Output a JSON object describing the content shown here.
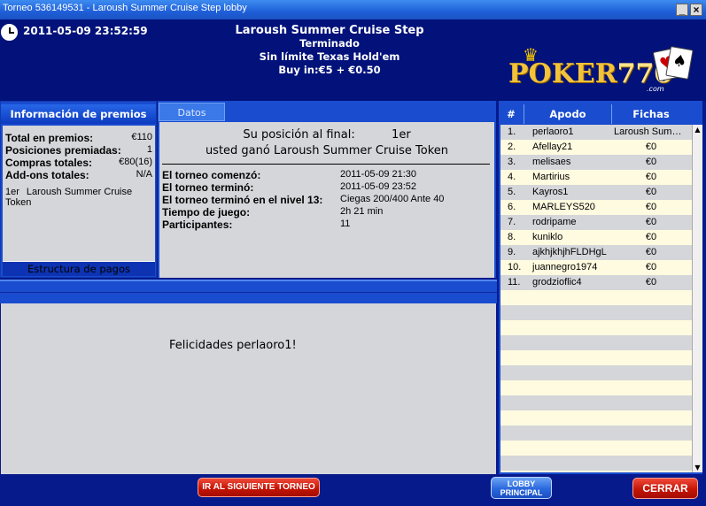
{
  "window": {
    "title": "Torneo 536149531 - Laroush Summer Cruise Step lobby",
    "minimize": "_",
    "close": "×"
  },
  "header": {
    "datetime": "2011-05-09 23:52:59",
    "name": "Laroush Summer Cruise Step",
    "status": "Terminado",
    "game": "Sin límite Texas Hold'em",
    "buyin": "Buy in:€5 + €0.50",
    "logo_text": "POKER",
    "logo_num": "770",
    "logo_com": ".com"
  },
  "prizes": {
    "title": "Información de premios",
    "rows": [
      {
        "k": "Total en premios:",
        "v": "€110"
      },
      {
        "k": "Posiciones premiadas:",
        "v": "1"
      },
      {
        "k": "Compras totales:",
        "v": "€80(16)"
      },
      {
        "k": "Add-ons totales:",
        "v": "N/A"
      }
    ],
    "place": "1er",
    "place_prize": "Laroush Summer Cruise Token",
    "footer": "Estructura de pagos"
  },
  "details": {
    "tab": "Datos",
    "position_line": "Su posición al final:          1er",
    "won_line": "usted ganó Laroush Summer Cruise Token",
    "rows": [
      {
        "k": "El torneo comenzó:",
        "v": "2011-05-09 21:30"
      },
      {
        "k": "El torneo terminó:",
        "v": "2011-05-09 23:52"
      },
      {
        "k": "El torneo terminó en el nivel 13:",
        "v": "Ciegas 200/400 Ante 40"
      },
      {
        "k": "Tiempo de juego:",
        "v": "2h 21 min"
      },
      {
        "k": "Participantes:",
        "v": "11"
      }
    ]
  },
  "message": "Felicidades perlaoro1!",
  "players": {
    "headers": [
      "#",
      "Apodo",
      "Fichas"
    ],
    "rows": [
      {
        "n": "1.",
        "name": "perlaoro1",
        "chips": "Laroush Summ…"
      },
      {
        "n": "2.",
        "name": "Afellay21",
        "chips": "€0"
      },
      {
        "n": "3.",
        "name": "melisaes",
        "chips": "€0"
      },
      {
        "n": "4.",
        "name": "Martirius",
        "chips": "€0"
      },
      {
        "n": "5.",
        "name": "Kayros1",
        "chips": "€0"
      },
      {
        "n": "6.",
        "name": "MARLEYS520",
        "chips": "€0"
      },
      {
        "n": "7.",
        "name": "rodripame",
        "chips": "€0"
      },
      {
        "n": "8.",
        "name": "kuniklo",
        "chips": "€0"
      },
      {
        "n": "9.",
        "name": "ajkhjkhjhFLDHgL",
        "chips": "€0"
      },
      {
        "n": "10.",
        "name": "juannegro1974",
        "chips": "€0"
      },
      {
        "n": "11.",
        "name": "grodzioflic4",
        "chips": "€0"
      }
    ]
  },
  "buttons": {
    "next": "IR AL SIGUIENTE TORNEO",
    "lobby1": "LOBBY",
    "lobby2": "PRINCIPAL",
    "close": "CERRAR"
  },
  "colors": {
    "dot_green": "#1c9a1c",
    "dot_orange": "#e0901c",
    "dot_red": "#d01c1c"
  }
}
